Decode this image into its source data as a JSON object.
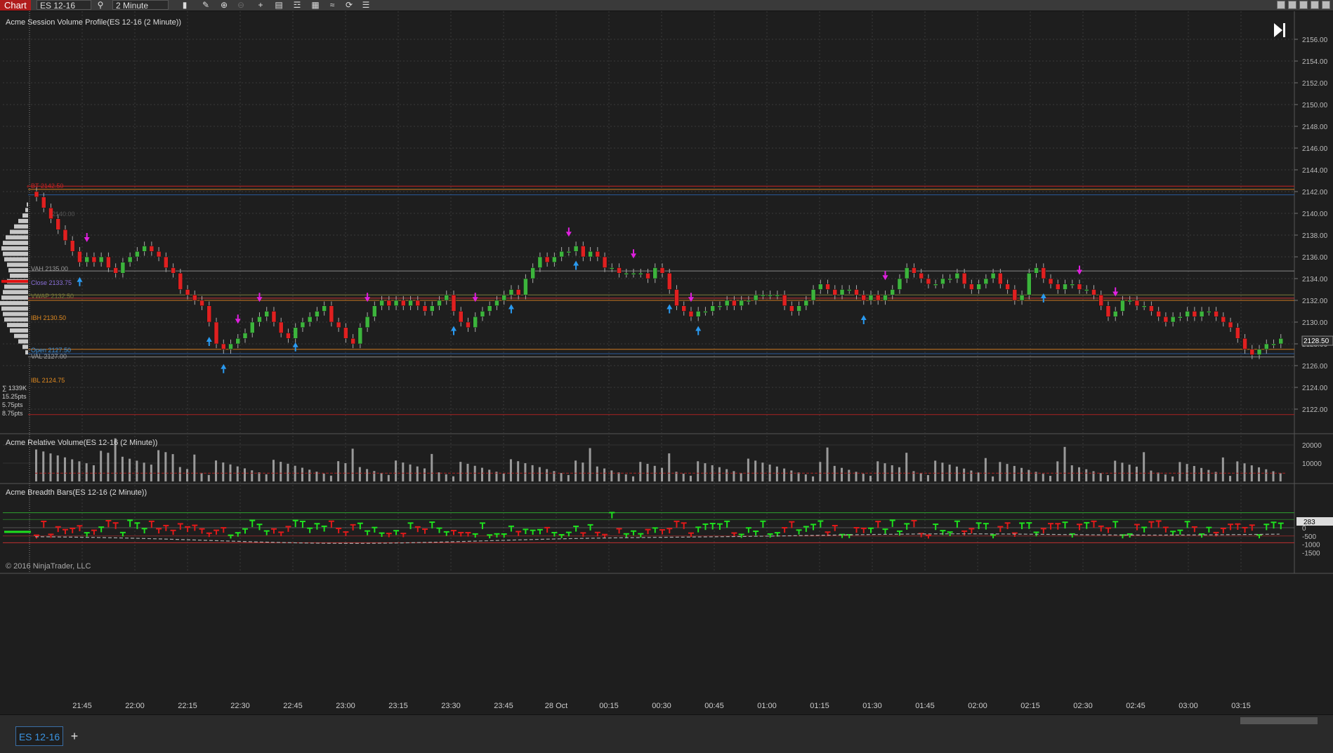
{
  "toolbar": {
    "title": "Chart",
    "instrument": "ES 12-16",
    "interval": "2 Minute"
  },
  "panels": {
    "price": {
      "title": "Acme Session Volume Profile(ES 12-16 (2 Minute))",
      "levels": [
        {
          "label": "BT 2142.50",
          "color": "#cc2222"
        },
        {
          "label": "2140.00",
          "color": "#555555"
        },
        {
          "label": "VAH 2135.00",
          "color": "#9a9a9a"
        },
        {
          "label": "Close 2133.75",
          "color": "#8a6fd8"
        },
        {
          "label": "VWAP 2132.50",
          "color": "#7a7a3a"
        },
        {
          "label": "IBH 2130.50",
          "color": "#e08a20"
        },
        {
          "label": "Open 2127.50",
          "color": "#3b93e0"
        },
        {
          "label": "VAL 2127.00",
          "color": "#9a9a9a"
        },
        {
          "label": "IBL 2124.75",
          "color": "#e08a20"
        }
      ],
      "stats": [
        "∑ 1339K",
        "15.25pts",
        "5.75pts",
        "8.75pts"
      ],
      "y_axis": [
        "2156.00",
        "2154.00",
        "2152.00",
        "2150.00",
        "2148.00",
        "2146.00",
        "2144.00",
        "2142.00",
        "2140.00",
        "2138.00",
        "2136.00",
        "2134.00",
        "2132.00",
        "2130.00",
        "2128.00",
        "2126.00",
        "2124.00",
        "2122.00"
      ],
      "last_price": "2128.50"
    },
    "volume": {
      "title": "Acme Relative Volume(ES 12-16 (2 Minute))",
      "y_axis": [
        "20000",
        "10000"
      ]
    },
    "breadth": {
      "title": "Acme Breadth Bars(ES 12-16 (2 Minute))",
      "y_axis": [
        "500",
        "0",
        "-500",
        "-1000",
        "-1500"
      ],
      "last_value": "283",
      "copyright": "© 2016 NinjaTrader, LLC"
    }
  },
  "x_axis": [
    "21:45",
    "22:00",
    "22:15",
    "22:30",
    "22:45",
    "23:00",
    "23:15",
    "23:30",
    "23:45",
    "28 Oct",
    "00:15",
    "00:30",
    "00:45",
    "01:00",
    "01:15",
    "01:30",
    "01:45",
    "02:00",
    "02:15",
    "02:30",
    "02:45",
    "03:00",
    "03:15"
  ],
  "tabs": [
    {
      "label": "ES 12-16"
    }
  ],
  "chart_data": {
    "type": "candlestick",
    "title": "Acme Session Volume Profile(ES 12-16 (2 Minute))",
    "closes": [
      2141.5,
      2140.5,
      2139.5,
      2138.5,
      2137.5,
      2136.5,
      2135.5,
      2136.0,
      2135.5,
      2136.0,
      2135.0,
      2134.5,
      2135.5,
      2136.0,
      2136.5,
      2137.0,
      2136.5,
      2136.0,
      2135.0,
      2134.5,
      2133.0,
      2132.5,
      2132.0,
      2131.5,
      2130.0,
      2128.0,
      2127.5,
      2128.0,
      2128.5,
      2129.0,
      2130.0,
      2130.5,
      2131.0,
      2130.0,
      2129.0,
      2128.5,
      2129.5,
      2130.0,
      2130.5,
      2131.0,
      2131.5,
      2130.0,
      2129.5,
      2128.5,
      2128.0,
      2129.5,
      2130.5,
      2131.5,
      2132.0,
      2131.5,
      2132.0,
      2131.5,
      2132.0,
      2131.5,
      2131.0,
      2131.5,
      2132.0,
      2132.5,
      2131.0,
      2130.0,
      2129.5,
      2130.5,
      2131.0,
      2131.5,
      2132.0,
      2132.5,
      2133.0,
      2132.5,
      2134.0,
      2135.0,
      2136.0,
      2135.5,
      2136.0,
      2136.5,
      2136.5,
      2137.0,
      2136.0,
      2136.5,
      2136.0,
      2135.0,
      2135.0,
      2134.5,
      2134.5,
      2134.5,
      2134.5,
      2134.0,
      2135.0,
      2134.5,
      2133.0,
      2131.5,
      2131.0,
      2130.5,
      2131.0,
      2131.0,
      2131.5,
      2131.5,
      2132.0,
      2131.5,
      2132.0,
      2132.0,
      2132.5,
      2132.5,
      2132.5,
      2132.5,
      2131.5,
      2131.0,
      2131.5,
      2132.0,
      2133.0,
      2133.5,
      2133.0,
      2132.5,
      2133.0,
      2133.0,
      2132.5,
      2132.0,
      2132.5,
      2132.0,
      2132.5,
      2133.0,
      2134.0,
      2135.0,
      2134.5,
      2134.0,
      2133.5,
      2133.5,
      2134.0,
      2134.0,
      2134.5,
      2133.5,
      2133.0,
      2133.5,
      2134.0,
      2134.5,
      2133.5,
      2133.0,
      2132.0,
      2132.5,
      2134.5,
      2135.0,
      2134.0,
      2133.5,
      2133.0,
      2133.5,
      2133.5,
      2133.0,
      2133.0,
      2132.5,
      2131.5,
      2130.5,
      2131.0,
      2132.0,
      2132.0,
      2131.5,
      2131.5,
      2131.0,
      2130.5,
      2130.0,
      2130.5,
      2130.5,
      2131.0,
      2130.5,
      2131.0,
      2131.0,
      2130.5,
      2130.0,
      2129.5,
      2128.5,
      2127.5,
      2127.0,
      2127.5,
      2128.0,
      2128.0,
      2128.5
    ]
  }
}
